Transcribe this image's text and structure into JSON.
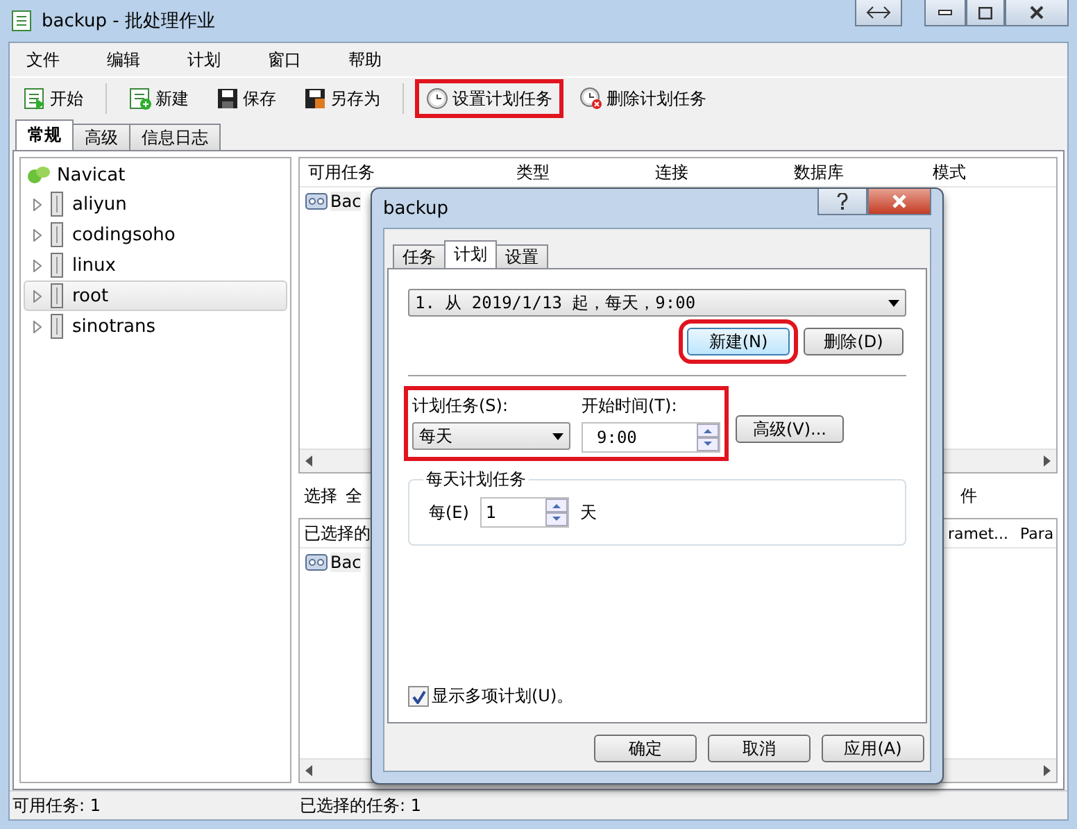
{
  "window": {
    "title": "backup - 批处理作业"
  },
  "menu": [
    "文件",
    "编辑",
    "计划",
    "窗口",
    "帮助"
  ],
  "toolbar": [
    {
      "label": "开始",
      "highlighted": false
    },
    {
      "label": "新建",
      "highlighted": false
    },
    {
      "label": "保存",
      "highlighted": false
    },
    {
      "label": "另存为",
      "highlighted": false
    },
    {
      "label": "设置计划任务",
      "highlighted": true
    },
    {
      "label": "删除计划任务",
      "highlighted": false
    }
  ],
  "tabs": [
    {
      "label": "常规",
      "selected": true
    },
    {
      "label": "高级",
      "selected": false
    },
    {
      "label": "信息日志",
      "selected": false
    }
  ],
  "tree": {
    "label": "Navicat",
    "children": [
      {
        "label": "aliyun",
        "selected": false
      },
      {
        "label": "codingsoho",
        "selected": false
      },
      {
        "label": "linux",
        "selected": false
      },
      {
        "label": "root",
        "selected": true
      },
      {
        "label": "sinotrans",
        "selected": false
      }
    ]
  },
  "available_tasks": {
    "columns": [
      "可用任务",
      "类型",
      "连接",
      "数据库",
      "模式"
    ],
    "rows": [
      {
        "name": "Bac"
      }
    ]
  },
  "selected_toolbar": [
    "选择",
    "全",
    "件"
  ],
  "selected_tasks": {
    "columns": [
      "已选择的",
      "ramet...",
      "Para"
    ],
    "rows": [
      {
        "name": "Bac"
      }
    ]
  },
  "status_bar": [
    "可用任务: 1",
    "已选择的任务: 1"
  ],
  "dialog": {
    "title": "backup",
    "tabs": [
      {
        "label": "任务",
        "selected": false
      },
      {
        "label": "计划",
        "selected": true
      },
      {
        "label": "设置",
        "selected": false
      }
    ],
    "schedule_select": "1. 从 2019/1/13 起，每天，9:00",
    "schedule_buttons": [
      {
        "label": "新建(N)",
        "highlighted": true
      },
      {
        "label": "删除(D)",
        "highlighted": false
      }
    ],
    "fields_highlighted": true,
    "schedule_type": {
      "label": "计划任务(S):",
      "value": "每天"
    },
    "start_time": {
      "label": "开始时间(T):",
      "value": "9:00"
    },
    "advanced_button": "高级(V)...",
    "daily_group": {
      "title": "每天计划任务",
      "every_label": "每(E)",
      "every_value": "1",
      "unit": "天"
    },
    "show_multiple": {
      "label": "显示多项计划(U)。",
      "checked": true
    },
    "footer_buttons": [
      "确定",
      "取消",
      "应用(A)"
    ]
  }
}
